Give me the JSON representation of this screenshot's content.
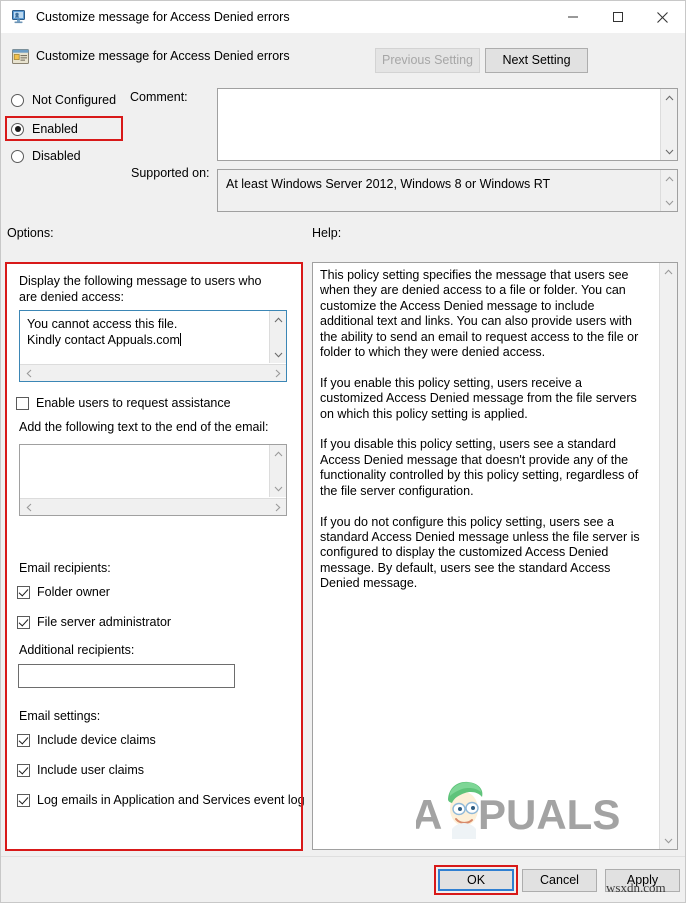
{
  "window": {
    "title": "Customize message for Access Denied errors",
    "title_icon": "computer-policy-icon",
    "minimize_label": "Minimize",
    "maximize_label": "Maximize",
    "close_label": "Close"
  },
  "header": {
    "icon": "policy-setting-icon",
    "title": "Customize message for Access Denied errors",
    "previous_setting": "Previous Setting",
    "next_setting": "Next Setting"
  },
  "state": {
    "options": [
      {
        "label": "Not Configured",
        "checked": false
      },
      {
        "label": "Enabled",
        "checked": true
      },
      {
        "label": "Disabled",
        "checked": false
      }
    ]
  },
  "comment": {
    "label": "Comment:",
    "value": ""
  },
  "supported_on": {
    "label": "Supported on:",
    "value": "At least Windows Server 2012, Windows 8 or Windows RT"
  },
  "panels": {
    "options_label": "Options:",
    "help_label": "Help:"
  },
  "options": {
    "message_label": "Display the following message to users who are denied access:",
    "message_value": "You cannot access this file.\nKindly contact Appuals.com",
    "enable_assistance": {
      "label": "Enable users to request assistance",
      "checked": false
    },
    "email_text_label": "Add the following text to the end of the email:",
    "email_text_value": "",
    "recipients_label": "Email recipients:",
    "recipients": [
      {
        "label": "Folder owner",
        "checked": true
      },
      {
        "label": "File server administrator",
        "checked": true
      }
    ],
    "additional_recipients_label": "Additional recipients:",
    "additional_recipients_value": "",
    "settings_label": "Email settings:",
    "settings": [
      {
        "label": "Include device claims",
        "checked": true
      },
      {
        "label": "Include user claims",
        "checked": true
      },
      {
        "label": "Log emails in Application and Services event log",
        "checked": true
      }
    ]
  },
  "help": {
    "text": "This policy setting specifies the message that users see when they are denied access to a file or folder. You can customize the Access Denied message to include additional text and links. You can also provide users with the ability to send an email to request access to the file or folder to which they were denied access.\n\nIf you enable this policy setting, users receive a customized Access Denied message from the file servers on which this policy setting is applied.\n\nIf you disable this policy setting, users see a standard Access Denied message that doesn't provide any of the functionality controlled by this policy setting, regardless of the file server configuration.\n\nIf you do not configure this policy setting, users see a standard Access Denied message unless the file server is configured to display the customized Access Denied message. By default, users see the standard Access Denied message."
  },
  "footer": {
    "ok": "OK",
    "cancel": "Cancel",
    "apply": "Apply"
  },
  "watermark": {
    "brand": "APPUALS",
    "site": "wsxdn.com"
  },
  "colors": {
    "annotation_red": "#d81919",
    "focus_blue": "#2f7fd1",
    "dialog_bg": "#f0f0f0",
    "field_bg": "#ffffff"
  }
}
